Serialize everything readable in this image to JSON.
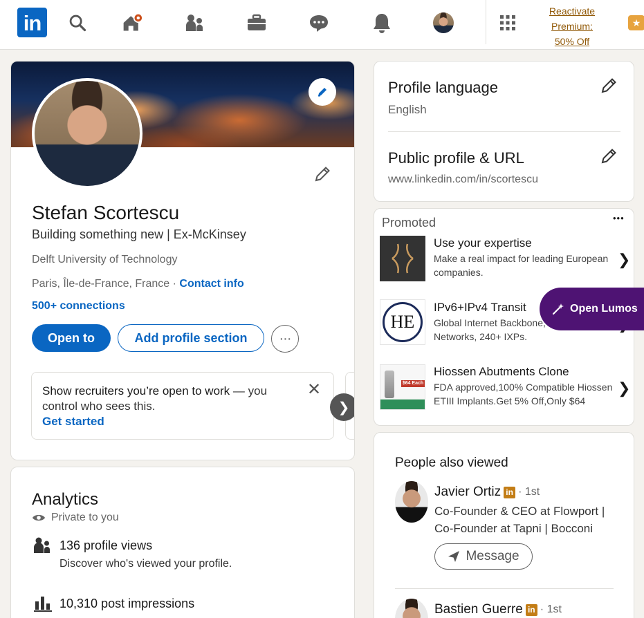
{
  "nav": {
    "logo": "in",
    "icons": [
      "search-icon",
      "home-icon",
      "my-network-icon",
      "jobs-icon",
      "messaging-icon",
      "notifications-icon",
      "me-avatar",
      "grid-icon"
    ],
    "reactivate_lines": [
      "Reactivate",
      "Premium:",
      "50% Off"
    ],
    "accent": "#0a66c2"
  },
  "profile": {
    "name": "Stefan Scortescu",
    "headline": "Building something new | Ex-McKinsey",
    "school": "Delft University of Technology",
    "location": "Paris, Île-de-France, France",
    "location_sep": " · ",
    "contact_info": "Contact info",
    "connections": "500+ connections",
    "open_to": "Open to",
    "add_section": "Add profile section",
    "more": "···",
    "otw_bold": "Show recruiters you’re open to work",
    "otw_rest": " — you control who sees this.",
    "otw_link": "Get started",
    "otw_close": "✕",
    "carousel_next": "❯"
  },
  "analytics": {
    "title": "Analytics",
    "privacy": "Private to you",
    "rows": [
      {
        "title": "136 profile views",
        "sub": "Discover who's viewed your profile."
      },
      {
        "title": "10,310 post impressions",
        "sub": ""
      }
    ]
  },
  "settings": {
    "language_title": "Profile language",
    "language_value": "English",
    "url_title": "Public profile & URL",
    "url_value": "www.linkedin.com/in/scortescu"
  },
  "promoted": {
    "label": "Promoted",
    "more": "•••",
    "ads": [
      {
        "title": "Use your expertise",
        "desc": "Make a real impact for leading European companies."
      },
      {
        "title": "IPv6+IPv4 Transit",
        "desc": "Global Internet Backbone, sessions, 8,300 Networks, 240+ IXPs.",
        "logo": "HE"
      },
      {
        "title": "Hiossen Abutments Clone",
        "desc": "FDA approved,100% Compatible Hiossen ETIII Implants.Get 5% Off,Only $64",
        "thumb_text": "$64 Each"
      }
    ],
    "chevron": "❯"
  },
  "lumos": {
    "label": "Open Lumos",
    "color": "#4e1373"
  },
  "people": {
    "title": "People also viewed",
    "items": [
      {
        "name": "Javier Ortiz",
        "degree": "· 1st",
        "title": "Co-Founder & CEO at Flowport | Co-Founder at Tapni | Bocconi",
        "button": "Message"
      },
      {
        "name": "Bastien Guerre",
        "degree": "· 1st"
      }
    ],
    "li_badge": "in"
  }
}
